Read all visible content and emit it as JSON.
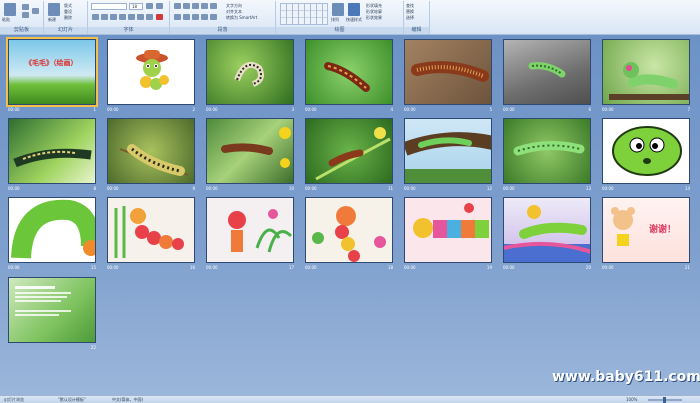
{
  "ribbon": {
    "groups": [
      {
        "label": "剪贴板"
      },
      {
        "label": "幻灯片"
      },
      {
        "label": "字体"
      },
      {
        "label": "段落"
      },
      {
        "label": "绘图"
      },
      {
        "label": "编辑"
      }
    ],
    "buttons": {
      "paste": "粘贴",
      "new_slide": "新建",
      "layout": "版式",
      "reset": "重设",
      "delete": "删除",
      "text_direction": "文字方向",
      "align_text": "对齐文本",
      "smartart": "转换为 SmartArt",
      "arrange": "排列",
      "quick_styles": "快速样式",
      "shape_fill": "形状填充",
      "shape_outline": "形状轮廓",
      "shape_effects": "形状效果",
      "find": "查找",
      "replace": "替换",
      "select": "选择"
    },
    "font_size": "18"
  },
  "slides": [
    {
      "num": "1",
      "time": "00:00",
      "title": "《毛毛》（绘画）"
    },
    {
      "num": "2",
      "time": "00:00"
    },
    {
      "num": "3",
      "time": "00:00"
    },
    {
      "num": "4",
      "time": "00:00"
    },
    {
      "num": "5",
      "time": "00:00"
    },
    {
      "num": "6",
      "time": "00:00"
    },
    {
      "num": "7",
      "time": "00:00"
    },
    {
      "num": "8",
      "time": "00:00"
    },
    {
      "num": "9",
      "time": "00:00"
    },
    {
      "num": "10",
      "time": "00:00"
    },
    {
      "num": "11",
      "time": "00:00"
    },
    {
      "num": "12",
      "time": "00:00"
    },
    {
      "num": "13",
      "time": "00:00"
    },
    {
      "num": "14",
      "time": "00:00"
    },
    {
      "num": "15",
      "time": "00:00"
    },
    {
      "num": "16",
      "time": "00:00"
    },
    {
      "num": "17",
      "time": "00:00"
    },
    {
      "num": "18",
      "time": "00:00"
    },
    {
      "num": "19",
      "time": "00:00"
    },
    {
      "num": "20",
      "time": "00:00"
    },
    {
      "num": "21",
      "time": "00:00",
      "title": "谢谢！"
    },
    {
      "num": "22",
      "time": ""
    }
  ],
  "watermark": "www.baby611.com",
  "status": {
    "view": "幻灯片浏览",
    "theme": "\"默认设计模板\"",
    "language": "中文(简体，中国)",
    "zoom": "100%"
  }
}
